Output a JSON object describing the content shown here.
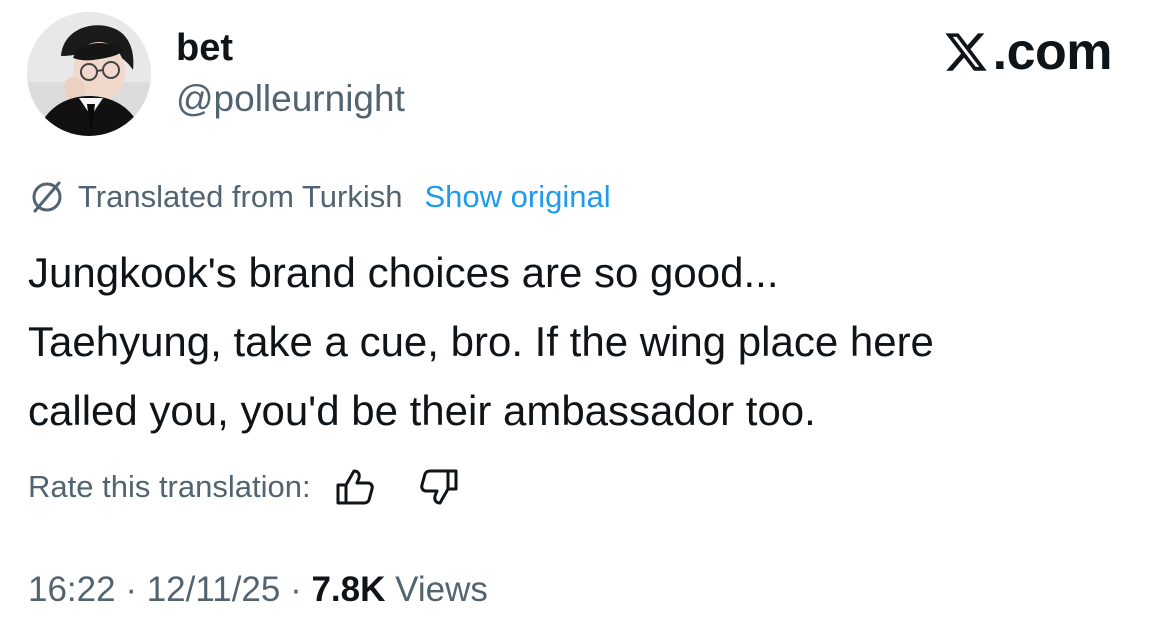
{
  "post": {
    "display_name": "bet",
    "handle": "@polleurnight",
    "avatar_icon": "profile-photo",
    "watermark": "X.com",
    "translation": {
      "icon": "translate-icon",
      "label": "Translated from Turkish",
      "action": "Show original"
    },
    "text_lines": [
      "Jungkook's brand choices are so good...",
      "Taehyung, take a cue, bro. If the wing place here",
      "called you, you'd be their ambassador too."
    ],
    "rating": {
      "label": "Rate this translation:",
      "up_icon": "thumbs-up-icon",
      "down_icon": "thumbs-down-icon"
    },
    "meta": {
      "time": "16:22",
      "separator": " · ",
      "date": "12/11/25",
      "views_count": "7.8K",
      "views_label": " Views"
    }
  },
  "colors": {
    "text_primary": "#0f1419",
    "text_secondary": "#536471",
    "link": "#1d9bf0",
    "background": "#ffffff"
  }
}
